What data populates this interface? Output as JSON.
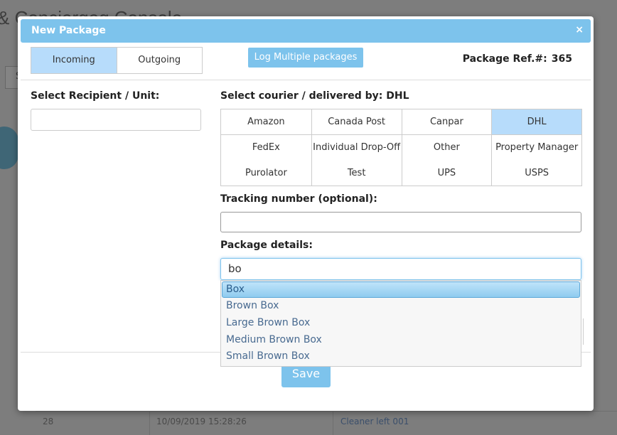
{
  "background": {
    "title": "& Conciergeg Console",
    "button_glyph": "S",
    "footer_row": {
      "id": "28",
      "datetime": "10/09/2019 15:28:26",
      "note": "Cleaner left 001"
    }
  },
  "modal": {
    "title": "New Package",
    "close_glyph": "×",
    "toggle": {
      "incoming": "Incoming",
      "outgoing": "Outgoing"
    },
    "log_multiple_label": "Log Multiple packages",
    "ref_label": "Package Ref.#:",
    "ref_value": "365",
    "recipient_label": "Select Recipient / Unit:",
    "recipient_value": "",
    "courier_label": "Select courier / delivered by:",
    "courier_selected": "DHL",
    "couriers": [
      "Amazon",
      "Canada Post",
      "Canpar",
      "DHL",
      "FedEx",
      "Individual Drop-Off",
      "Other",
      "Property Manager",
      "Purolator",
      "Test",
      "UPS",
      "USPS"
    ],
    "tracking_label": "Tracking number (optional):",
    "tracking_value": "",
    "details_label": "Package details:",
    "details_value": "bo",
    "suggestions": [
      "Box",
      "Brown Box",
      "Large Brown Box",
      "Medium Brown Box",
      "Small Brown Box"
    ],
    "save_label": "Save"
  },
  "colors": {
    "accent": "#7dc3ec",
    "selected": "#b7dcfb",
    "link": "#486a90"
  }
}
